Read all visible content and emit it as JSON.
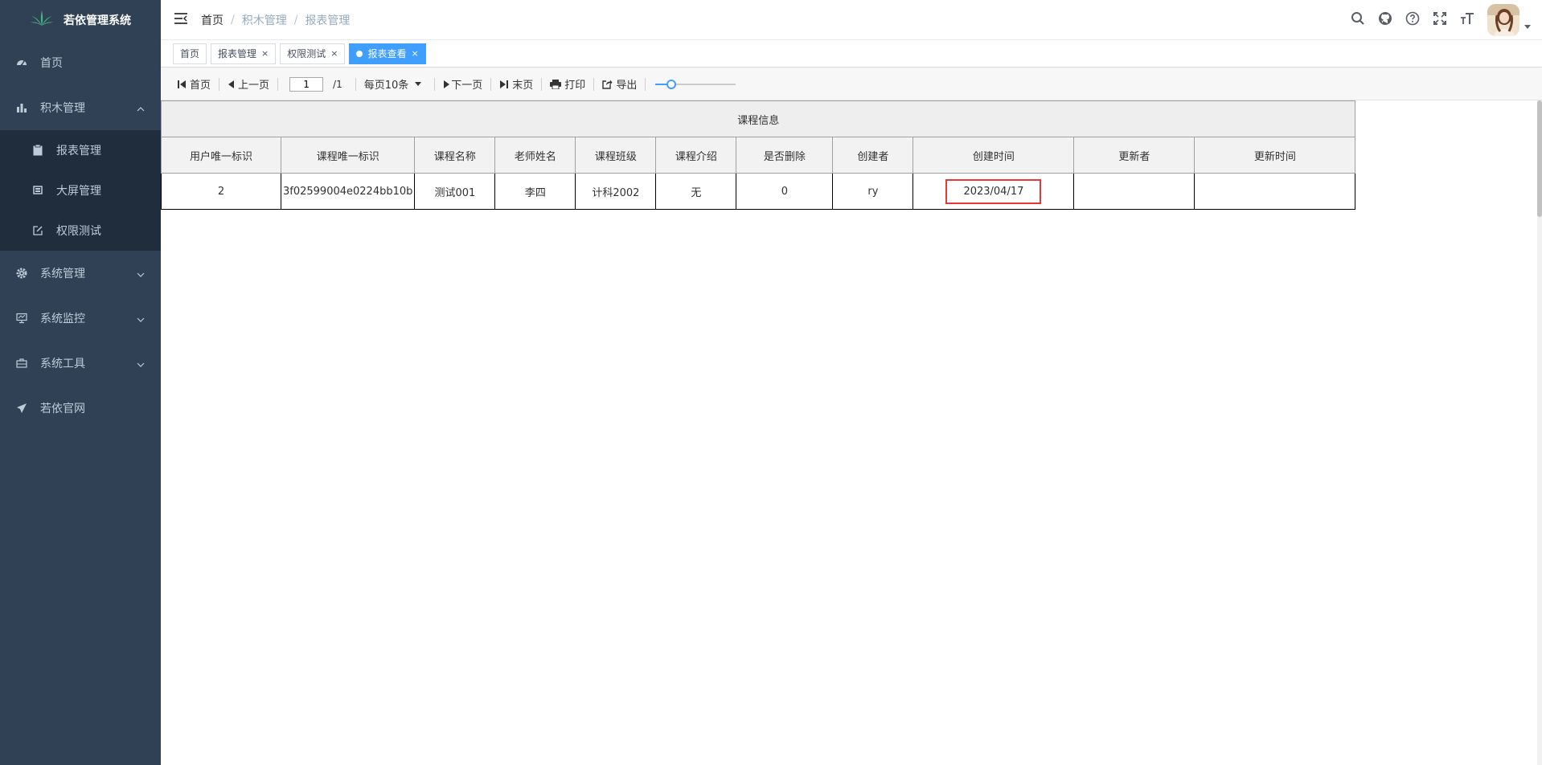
{
  "sidebar": {
    "logo_text": "若依管理系统",
    "items": [
      {
        "label": "首页",
        "icon": "dashboard-icon"
      },
      {
        "label": "积木管理",
        "icon": "chart-icon",
        "expanded": true,
        "children": [
          {
            "label": "报表管理",
            "icon": "clipboard-icon"
          },
          {
            "label": "大屏管理",
            "icon": "screen-icon"
          },
          {
            "label": "权限测试",
            "icon": "edit-icon"
          }
        ]
      },
      {
        "label": "系统管理",
        "icon": "gear-icon"
      },
      {
        "label": "系统监控",
        "icon": "monitor-icon"
      },
      {
        "label": "系统工具",
        "icon": "toolbox-icon"
      },
      {
        "label": "若依官网",
        "icon": "send-icon"
      }
    ]
  },
  "navbar": {
    "breadcrumb": [
      "首页",
      "积木管理",
      "报表管理"
    ],
    "breadcrumb_sep": "/",
    "icons": [
      "search-icon",
      "github-icon",
      "question-icon",
      "fullscreen-icon",
      "font-size-icon"
    ]
  },
  "tags": [
    {
      "label": "首页",
      "closable": false,
      "active": false
    },
    {
      "label": "报表管理",
      "closable": true,
      "active": false
    },
    {
      "label": "权限测试",
      "closable": true,
      "active": false
    },
    {
      "label": "报表查看",
      "closable": true,
      "active": true
    }
  ],
  "tag_close": "×",
  "toolbar": {
    "first": "首页",
    "prev": "上一页",
    "page_value": "1",
    "page_total": "/1",
    "page_size": "每页10条",
    "next": "下一页",
    "last": "末页",
    "print": "打印",
    "export": "导出",
    "zoom_level": 0.15
  },
  "report": {
    "title": "课程信息",
    "columns": [
      "用户唯一标识",
      "课程唯一标识",
      "课程名称",
      "老师姓名",
      "课程班级",
      "课程介绍",
      "是否删除",
      "创建者",
      "创建时间",
      "更新者",
      "更新时间"
    ],
    "rows": [
      [
        "2",
        "3f02599004e0224bb10b",
        "测试001",
        "李四",
        "计科2002",
        "无",
        "0",
        "ry",
        "2023/04/17",
        "",
        ""
      ]
    ]
  },
  "colors": {
    "sidebar_bg": "#304156",
    "submenu_bg": "#1f2d3d",
    "accent": "#409eff",
    "highlight": "#e53935"
  }
}
